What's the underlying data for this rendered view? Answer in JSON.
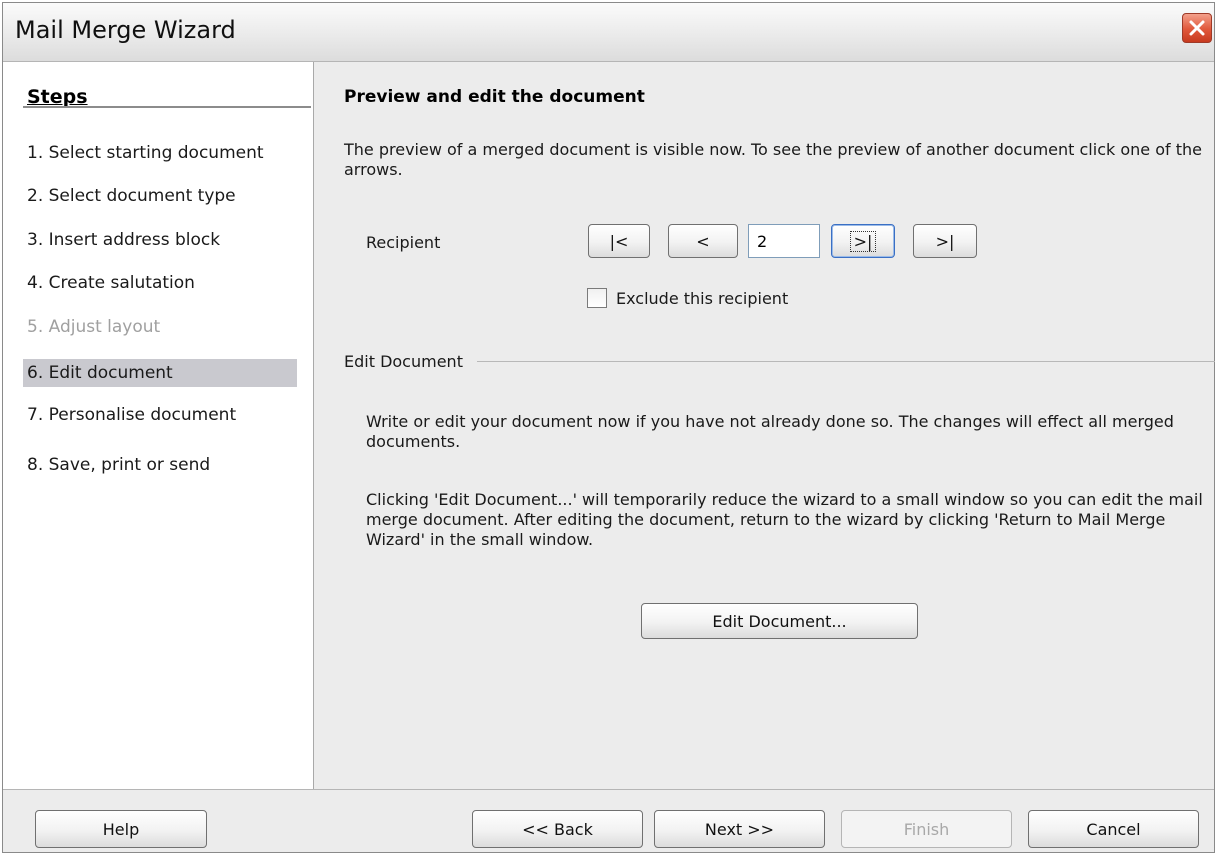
{
  "window": {
    "title": "Mail Merge Wizard"
  },
  "steps": {
    "title": "Steps",
    "items": [
      {
        "label": "1.  Select starting document",
        "state": "normal"
      },
      {
        "label": "2.  Select document type",
        "state": "normal"
      },
      {
        "label": "3.  Insert address block",
        "state": "normal"
      },
      {
        "label": "4.  Create salutation",
        "state": "normal"
      },
      {
        "label": "5.  Adjust layout",
        "state": "disabled"
      },
      {
        "label": "6.  Edit document",
        "state": "selected"
      },
      {
        "label": "7.  Personalise document",
        "state": "normal"
      },
      {
        "label": "8.  Save, print or send",
        "state": "normal"
      }
    ]
  },
  "preview": {
    "heading": "Preview and edit the document",
    "description": "The preview of a merged document is visible now. To see the preview of another document click one of the arrows.",
    "recipient_label": "Recipient",
    "first_label": "|<",
    "prev_label": "<",
    "recipient_value": "2",
    "next_label": ">|",
    "last_label": ">|",
    "exclude_label": "Exclude this recipient",
    "exclude_checked": false
  },
  "edit_group": {
    "title": "Edit Document",
    "para1": "Write or edit your document now if you have not already done so. The changes will effect all merged documents.",
    "para2": "Clicking 'Edit Document...' will temporarily reduce the wizard to a small window so you can edit the mail merge document. After editing the document, return to the wizard by clicking 'Return to Mail Merge Wizard' in the small window.",
    "button_label": "Edit Document..."
  },
  "buttons": {
    "help": "Help",
    "back": "<< Back",
    "next": "Next >>",
    "finish": "Finish",
    "cancel": "Cancel"
  },
  "colors": {
    "selected_step": "#c9c9cf",
    "disabled_text": "#a0a0a0",
    "close_button": "#e0573a"
  }
}
